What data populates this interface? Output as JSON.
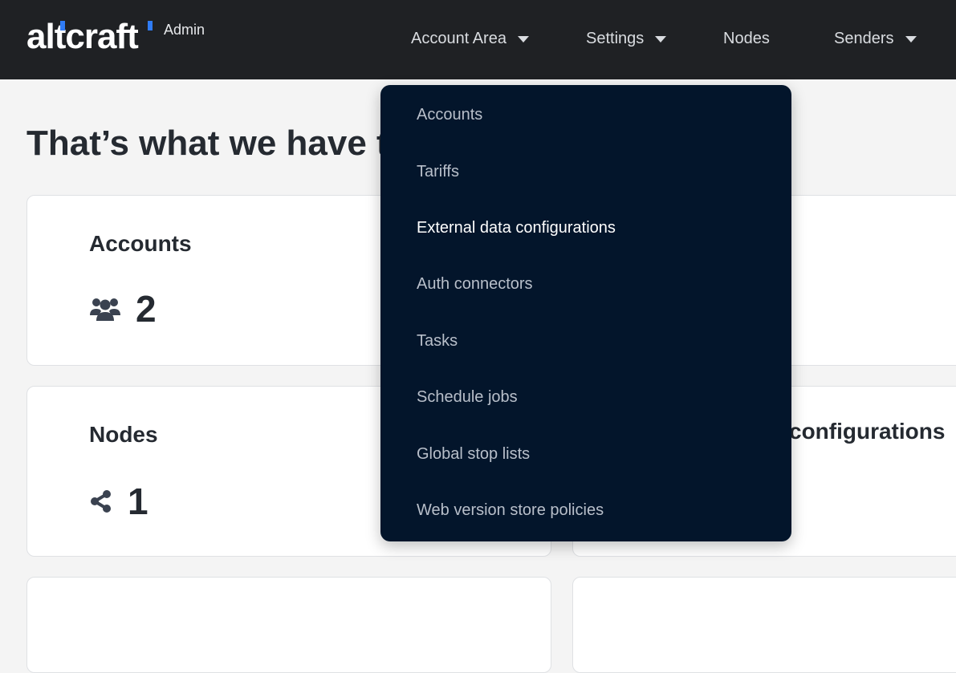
{
  "brand": {
    "logo_text": "altcraft",
    "tag": "Admin",
    "accent_color": "#2f7cf6"
  },
  "nav": [
    {
      "label": "Account Area",
      "has_caret": true
    },
    {
      "label": "Settings",
      "has_caret": true
    },
    {
      "label": "Nodes",
      "has_caret": false
    },
    {
      "label": "Senders",
      "has_caret": true
    }
  ],
  "page": {
    "title": "That’s what we have t"
  },
  "cards": {
    "accounts": {
      "title": "Accounts",
      "icon": "users-icon",
      "value": "2"
    },
    "nodes": {
      "title": "Nodes",
      "icon": "share-nodes-icon",
      "value": "1"
    },
    "right_second": {
      "title": "configurations"
    }
  },
  "dropdown": {
    "items": [
      {
        "label": "Accounts"
      },
      {
        "label": "Tariffs"
      },
      {
        "label": "External data configurations",
        "active": true
      },
      {
        "label": "Auth connectors"
      },
      {
        "label": "Tasks"
      },
      {
        "label": "Schedule jobs"
      },
      {
        "label": "Global stop lists"
      },
      {
        "label": "Web version store policies"
      }
    ]
  },
  "colors": {
    "topbar": "#1f2124",
    "dropdown_bg": "#03152b",
    "page_bg": "#f4f4f4"
  }
}
